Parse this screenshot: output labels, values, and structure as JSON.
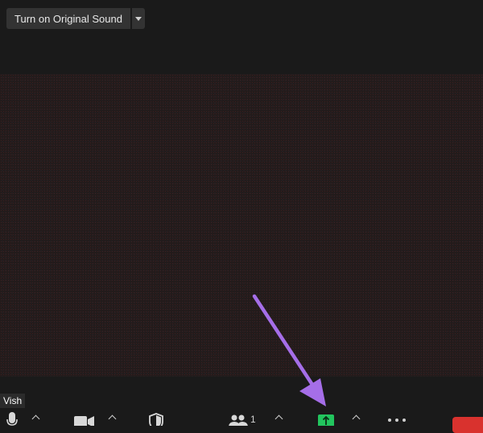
{
  "top_bar": {
    "original_sound_label": "Turn on Original Sound"
  },
  "video": {
    "participant_name": "Vish"
  },
  "toolbar": {
    "participants_count": "1",
    "icons": [
      "microphone-icon",
      "video-camera-icon",
      "shield-icon",
      "participants-icon",
      "share-screen-icon",
      "more-icon"
    ],
    "share_color": "#22c55e",
    "end_color": "#d9322e"
  },
  "annotation": {
    "arrow_color": "#a56ee8"
  }
}
